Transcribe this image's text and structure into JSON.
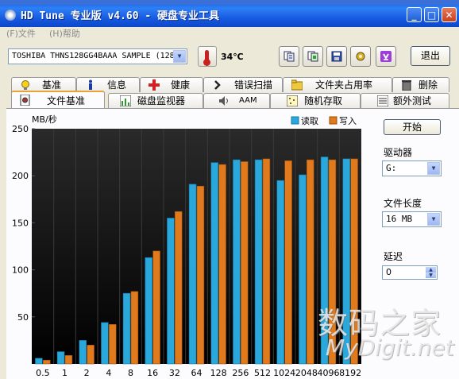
{
  "window": {
    "title": "HD Tune 专业版 v4.60 - 硬盘专业工具",
    "minimize": "_",
    "maximize": "□",
    "close": "✕"
  },
  "menu": {
    "file": "(F)文件",
    "help": "(H)帮助"
  },
  "toolbar": {
    "drive": "TOSHIBA THNS128GG4BAAA SAMPLE (128",
    "temperature": "34℃",
    "exit_label": "退出",
    "icons": [
      "copy-text-icon",
      "copy-screen-icon",
      "save-icon",
      "options-icon",
      "download-icon"
    ]
  },
  "tabs_row1": [
    {
      "label": "基准",
      "icon": "bulb-icon"
    },
    {
      "label": "信息",
      "icon": "info-icon"
    },
    {
      "label": "健康",
      "icon": "health-cross-icon"
    },
    {
      "label": "错误扫描",
      "icon": "scan-icon"
    },
    {
      "label": "文件夹占用率",
      "icon": "folder-icon"
    },
    {
      "label": "删除",
      "icon": "trash-icon"
    }
  ],
  "tabs_row2": [
    {
      "label": "文件基准",
      "icon": "file-benchmark-icon",
      "active": true
    },
    {
      "label": "磁盘监视器",
      "icon": "monitor-icon"
    },
    {
      "label": "AAM",
      "icon": "speaker-icon"
    },
    {
      "label": "随机存取",
      "icon": "random-access-icon"
    },
    {
      "label": "额外测试",
      "icon": "extra-tests-icon"
    }
  ],
  "side": {
    "start_label": "开始",
    "drive_label": "驱动器",
    "drive_value": "G:",
    "file_length_label": "文件长度",
    "file_length_value": "16 MB",
    "delay_label": "延迟",
    "delay_value": "0"
  },
  "watermark": {
    "cn": "数码之家",
    "en": "MyDigit.net"
  },
  "colors": {
    "read": "#2aa8dc",
    "write": "#e07a1c",
    "plot_bg": "#101010"
  },
  "chart_data": {
    "type": "bar",
    "ylabel": "MB/秒",
    "ylim": [
      0,
      250
    ],
    "yticks": [
      50,
      100,
      150,
      200,
      250
    ],
    "categories": [
      "0.5",
      "1",
      "2",
      "4",
      "8",
      "16",
      "32",
      "64",
      "128",
      "256",
      "512",
      "1024",
      "2048",
      "4096",
      "8192"
    ],
    "series": [
      {
        "name": "读取",
        "values": [
          6,
          13,
          25,
          44,
          75,
          113,
          155,
          191,
          214,
          217,
          217,
          195,
          201,
          220,
          218
        ]
      },
      {
        "name": "写入",
        "values": [
          4,
          9,
          20,
          42,
          77,
          120,
          162,
          189,
          212,
          215,
          218,
          216,
          217,
          217,
          218
        ]
      }
    ],
    "legend": "top-right",
    "grid": "vertical"
  }
}
